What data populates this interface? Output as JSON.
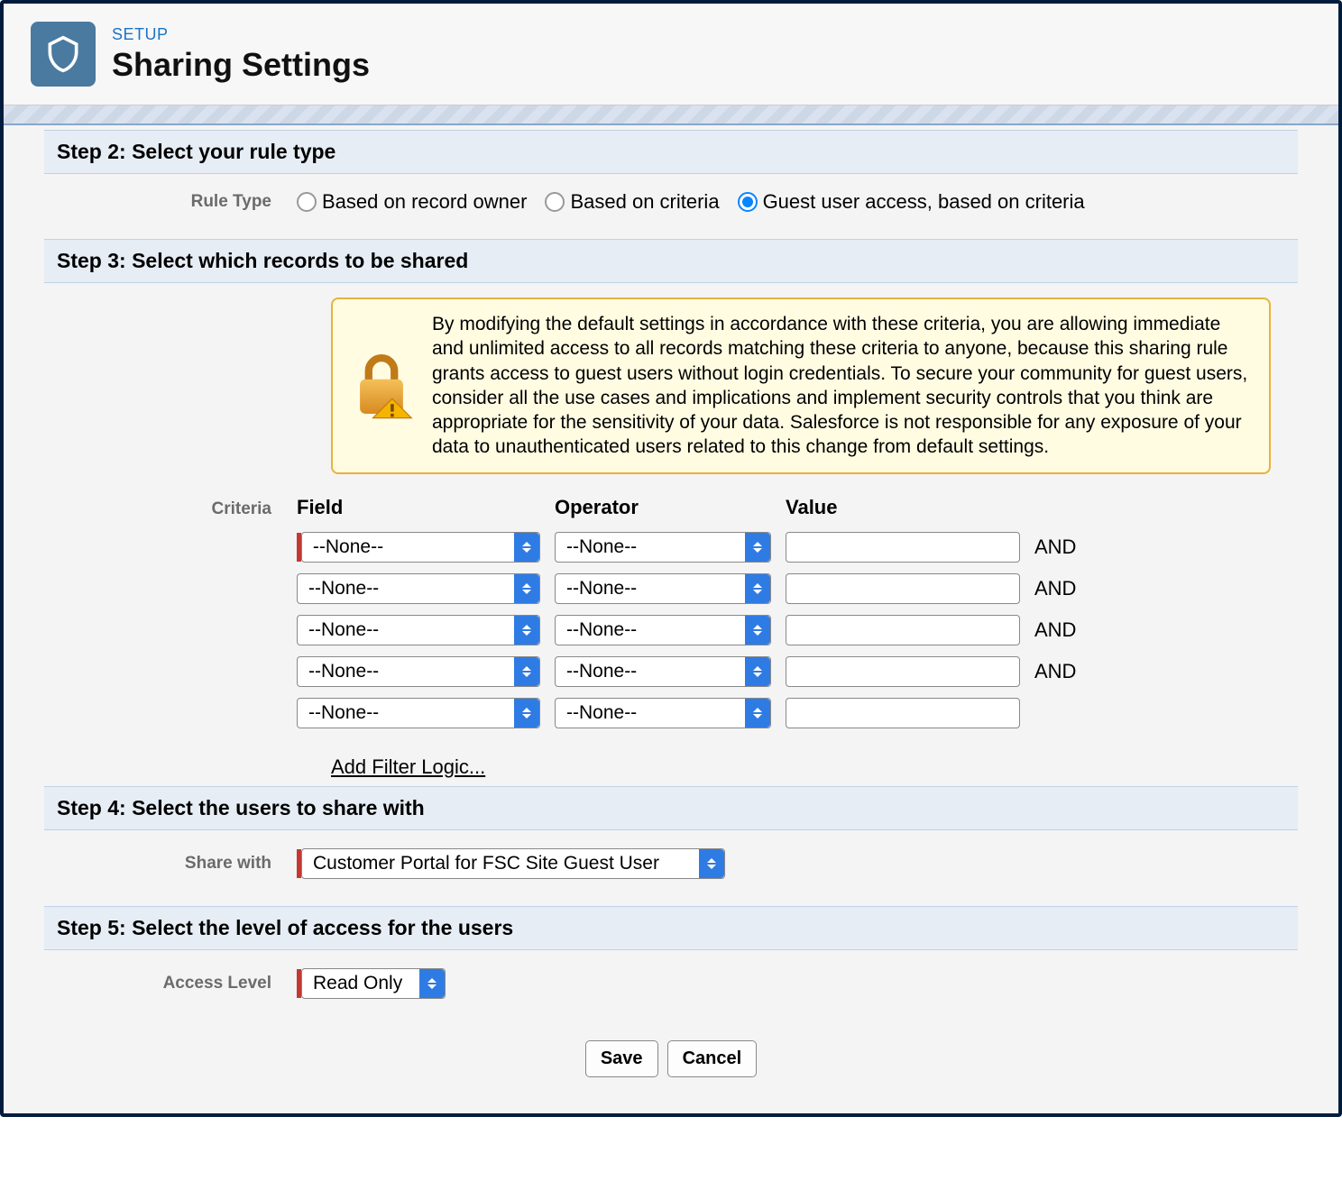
{
  "header": {
    "setup_label": "SETUP",
    "title": "Sharing Settings"
  },
  "step2": {
    "header": "Step 2: Select your rule type",
    "label": "Rule Type",
    "options": [
      {
        "label": "Based on record owner",
        "checked": false
      },
      {
        "label": "Based on criteria",
        "checked": false
      },
      {
        "label": "Guest user access, based on criteria",
        "checked": true
      }
    ]
  },
  "step3": {
    "header": "Step 3: Select which records to be shared",
    "warning": "By modifying the default settings in accordance with these criteria, you are allowing immediate and unlimited access to all records matching these criteria to anyone, because this sharing rule grants access to guest users without login credentials. To secure your community for guest users, consider all the use cases and implications and implement security controls that you think are appropriate for the sensitivity of your data. Salesforce is not responsible for any exposure of your data to unauthenticated users related to this change from default settings.",
    "criteria_label": "Criteria",
    "columns": {
      "field": "Field",
      "operator": "Operator",
      "value": "Value"
    },
    "rows": [
      {
        "field": "--None--",
        "operator": "--None--",
        "value": "",
        "logic": "AND",
        "required": true
      },
      {
        "field": "--None--",
        "operator": "--None--",
        "value": "",
        "logic": "AND",
        "required": false
      },
      {
        "field": "--None--",
        "operator": "--None--",
        "value": "",
        "logic": "AND",
        "required": false
      },
      {
        "field": "--None--",
        "operator": "--None--",
        "value": "",
        "logic": "AND",
        "required": false
      },
      {
        "field": "--None--",
        "operator": "--None--",
        "value": "",
        "logic": "",
        "required": false
      }
    ],
    "filter_logic_link": "Add Filter Logic..."
  },
  "step4": {
    "header": "Step 4: Select the users to share with",
    "label": "Share with",
    "value": "Customer Portal for FSC Site Guest User"
  },
  "step5": {
    "header": "Step 5: Select the level of access for the users",
    "label": "Access Level",
    "value": "Read Only"
  },
  "buttons": {
    "save": "Save",
    "cancel": "Cancel"
  }
}
